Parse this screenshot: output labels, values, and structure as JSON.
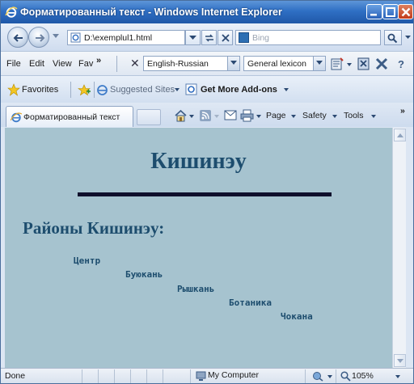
{
  "window": {
    "title": "Форматированный текст - Windows Internet Explorer"
  },
  "address": {
    "url": "D:\\exemplul1.html"
  },
  "search": {
    "placeholder": "Bing"
  },
  "menu": {
    "file": "File",
    "edit": "Edit",
    "view": "View",
    "favorites": "Fav",
    "overflow": "»",
    "language_pair": "English-Russian",
    "lexicon": "General lexicon"
  },
  "favorites_bar": {
    "favorites": "Favorites",
    "suggested_sites": "Suggested Sites",
    "get_more_addons": "Get More Add-ons"
  },
  "tab": {
    "label": "Форматированный текст"
  },
  "command_bar": {
    "page": "Page",
    "safety": "Safety",
    "tools": "Tools",
    "overflow": "»"
  },
  "content": {
    "title": "Кишинэу",
    "subtitle": "Районы Кишинэу:",
    "districts": [
      "Центр",
      "Буюкань",
      "Рышкань",
      "Ботаника",
      "Чокана"
    ],
    "background_color": "#a6c3cf",
    "heading_color": "#1d4d6e"
  },
  "status": {
    "text": "Done",
    "zone": "My Computer",
    "zoom": "105%"
  }
}
